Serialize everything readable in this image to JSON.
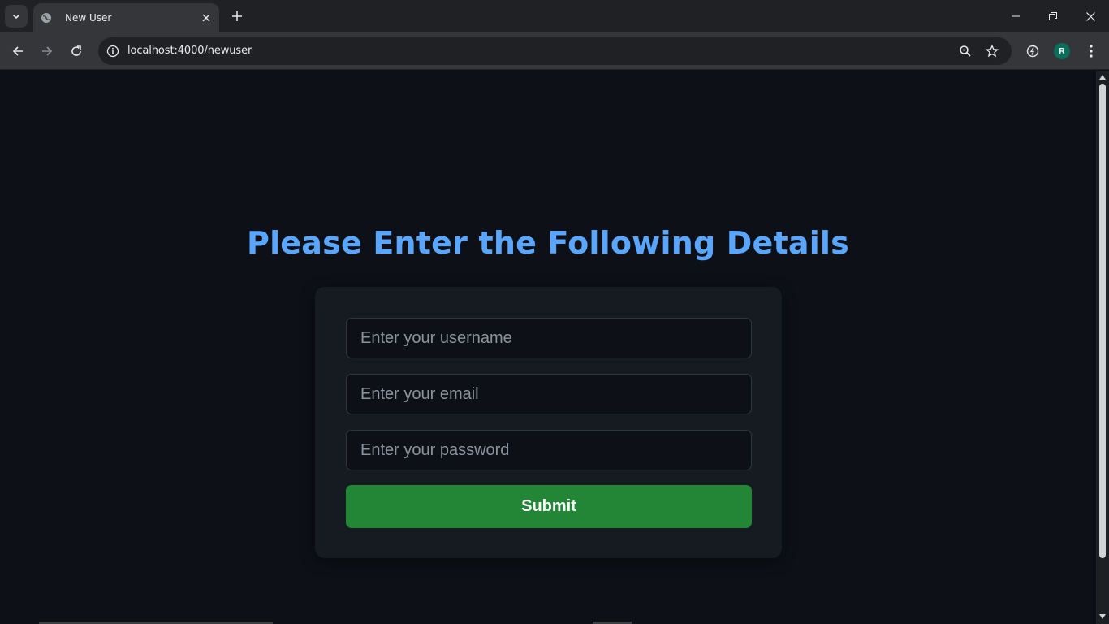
{
  "browser": {
    "tab_title": "New User",
    "url": "localhost:4000/newuser",
    "profile_initial": "R"
  },
  "page": {
    "heading": "Please Enter the Following Details",
    "form": {
      "username_placeholder": "Enter your username",
      "email_placeholder": "Enter your email",
      "password_placeholder": "Enter your password",
      "submit_label": "Submit"
    }
  },
  "colors": {
    "background": "#0d1117",
    "card": "#161b22",
    "heading": "#58a6ff",
    "submit": "#238636",
    "avatar": "#0b6e5a"
  }
}
